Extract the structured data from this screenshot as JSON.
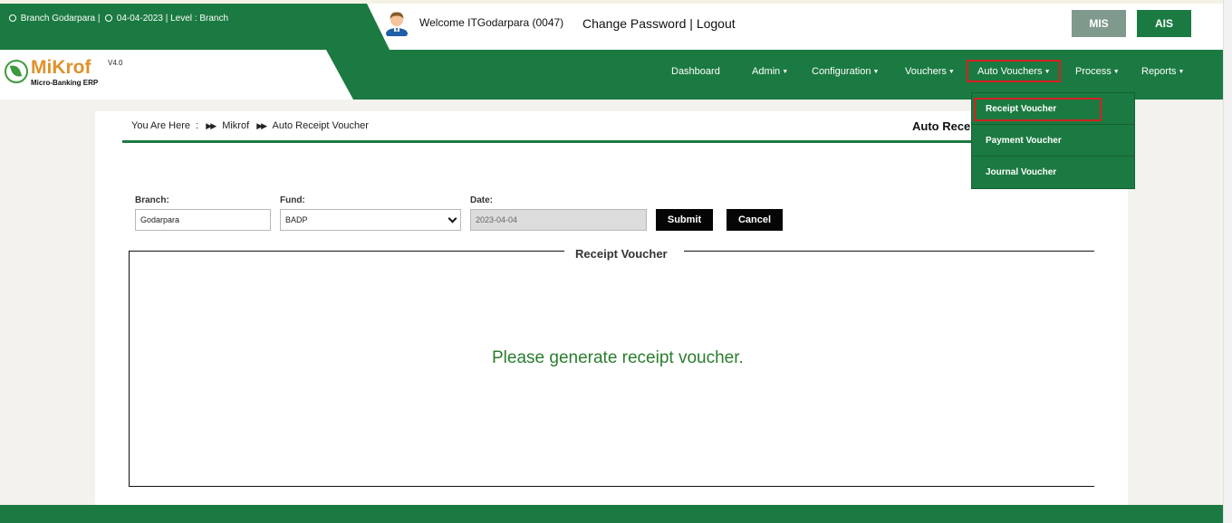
{
  "info_bar": {
    "branch": "Branch Godarpara |",
    "date_level": "04-04-2023 | Level : Branch"
  },
  "header": {
    "welcome": "Welcome ITGodarpara (0047)",
    "change_password": "Change Password",
    "separator": "|",
    "logout": "Logout",
    "mis_label": "MIS",
    "ais_label": "AIS"
  },
  "logo": {
    "name": "MiKrof",
    "version": "V4.0",
    "subtitle": "Micro-Banking ERP"
  },
  "nav": {
    "dashboard": "Dashboard",
    "admin": "Admin",
    "configuration": "Configuration",
    "vouchers": "Vouchers",
    "auto_vouchers": "Auto Vouchers",
    "process": "Process",
    "reports": "Reports"
  },
  "dropdown": {
    "items": [
      "Receipt Voucher",
      "Payment Voucher",
      "Journal Voucher"
    ]
  },
  "breadcrumb": {
    "prefix": "You Are Here",
    "colon": ":",
    "home": "Mikrof",
    "current": "Auto Receipt Voucher"
  },
  "page_heading": "Auto Receipt Voucher",
  "form": {
    "branch_label": "Branch:",
    "branch_value": "Godarpara",
    "fund_label": "Fund:",
    "fund_value": "BADP",
    "date_label": "Date:",
    "date_value": "2023-04-04",
    "submit": "Submit",
    "cancel": "Cancel"
  },
  "voucher_panel": {
    "legend": "Receipt Voucher",
    "message": "Please generate receipt voucher."
  },
  "colors": {
    "brand_green": "#1b7a41",
    "logo_orange": "#e0912a",
    "highlight_red": "#d42020",
    "message_green": "#2a7d2e"
  }
}
